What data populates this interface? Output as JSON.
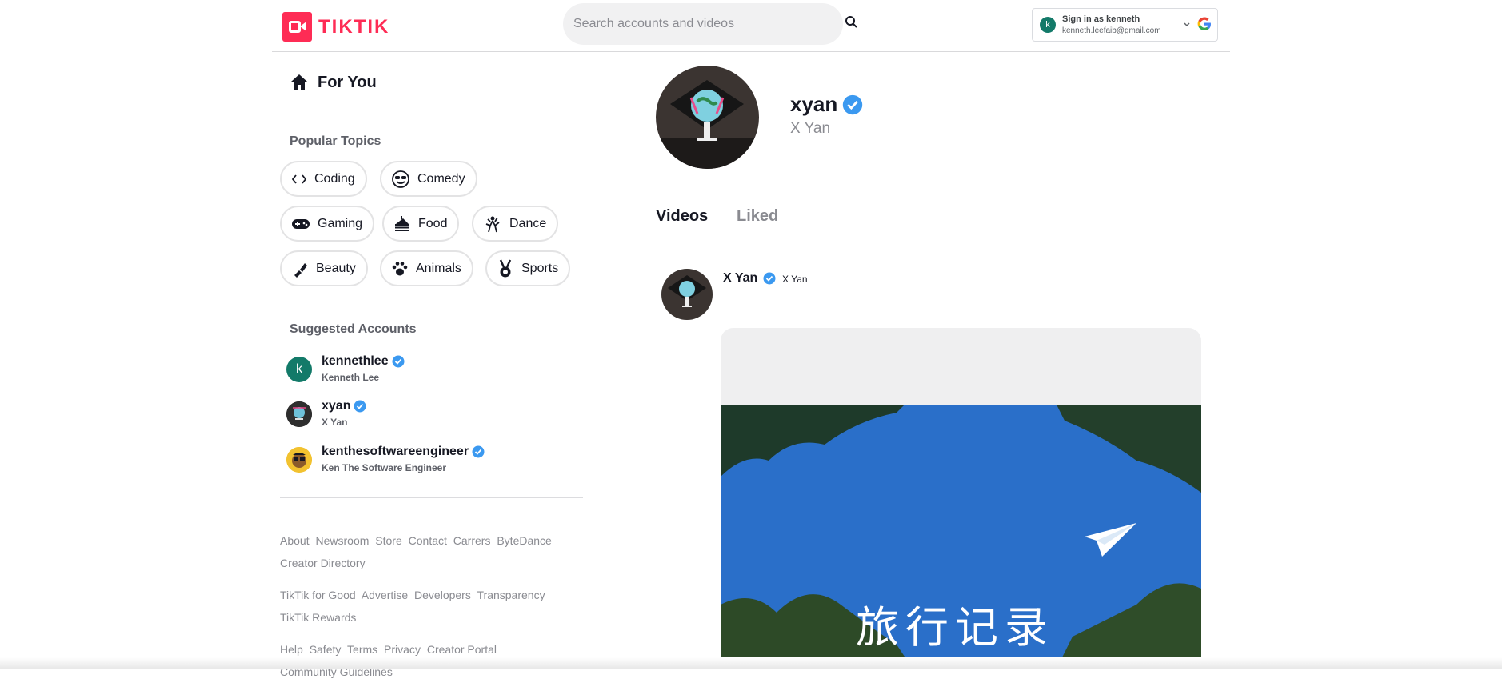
{
  "brand": {
    "name": "TIKTIK",
    "color": "#fe2c55"
  },
  "search": {
    "placeholder": "Search accounts and videos",
    "value": ""
  },
  "signin": {
    "title": "Sign in as kenneth",
    "email": "kenneth.leefaib@gmail.com",
    "initial": "k"
  },
  "sidebar": {
    "for_you": "For You",
    "topics_title": "Popular Topics",
    "topics": [
      {
        "label": "Coding",
        "icon": "code-icon"
      },
      {
        "label": "Comedy",
        "icon": "sunglasses-face-icon"
      },
      {
        "label": "Gaming",
        "icon": "gamepad-icon"
      },
      {
        "label": "Food",
        "icon": "cake-icon"
      },
      {
        "label": "Dance",
        "icon": "dancer-icon"
      },
      {
        "label": "Beauty",
        "icon": "lipstick-icon"
      },
      {
        "label": "Animals",
        "icon": "paw-icon"
      },
      {
        "label": "Sports",
        "icon": "medal-icon"
      }
    ],
    "suggested_title": "Suggested Accounts",
    "accounts": [
      {
        "username": "kennethlee",
        "nickname": "Kenneth Lee",
        "initial": "k"
      },
      {
        "username": "xyan",
        "nickname": "X Yan"
      },
      {
        "username": "kenthesoftwareengineer",
        "nickname": "Ken The Software Engineer"
      }
    ],
    "footer": [
      [
        "About",
        "Newsroom",
        "Store",
        "Contact",
        "Carrers",
        "ByteDance"
      ],
      [
        "Creator Directory"
      ],
      [
        "TikTik for Good",
        "Advertise",
        "Developers",
        "Transparency"
      ],
      [
        "TikTik Rewards"
      ],
      [
        "Help",
        "Safety",
        "Terms",
        "Privacy",
        "Creator Portal"
      ],
      [
        "Community Guidelines"
      ]
    ]
  },
  "profile": {
    "username": "xyan",
    "nickname": "X Yan"
  },
  "tabs": [
    {
      "label": "Videos"
    },
    {
      "label": "Liked"
    }
  ],
  "post": {
    "name": "X Yan",
    "nickname": "X Yan",
    "caption": "旅行记录"
  },
  "colors": {
    "verified": "#3b99f0",
    "accent": "#fe2c55"
  }
}
